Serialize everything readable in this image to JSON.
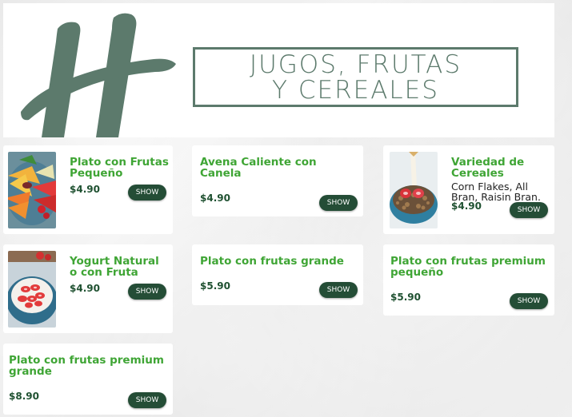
{
  "header": {
    "title_line1": "JUGOS, FRUTAS",
    "title_line2": "Y CEREALES",
    "brand_color": "#5c7a6c"
  },
  "colors": {
    "item_name": "#3fa535",
    "price": "#1f5131",
    "button_bg": "#244d36"
  },
  "items": [
    {
      "name": "Plato con Frutas Pequeño",
      "description": "",
      "price": "$4.90",
      "button": "SHOW",
      "image": "fruit-platter-photo"
    },
    {
      "name": "Avena Caliente con Canela",
      "description": "",
      "price": "$4.90",
      "button": "SHOW",
      "image": ""
    },
    {
      "name": "Variedad de Cereales",
      "description": "Corn Flakes, All Bran, Raisin Bran.",
      "price": "$4.90",
      "button": "SHOW",
      "image": "cereal-bowl-photo"
    },
    {
      "name": "Yogurt Natural o con Fruta",
      "description": "",
      "price": "$4.90",
      "button": "SHOW",
      "image": "yogurt-strawberry-photo"
    },
    {
      "name": "Plato con frutas grande",
      "description": "",
      "price": "$5.90",
      "button": "SHOW",
      "image": ""
    },
    {
      "name": "Plato con frutas premium pequeño",
      "description": "",
      "price": "$5.90",
      "button": "SHOW",
      "image": ""
    },
    {
      "name": "Plato con frutas premium grande",
      "description": "",
      "price": "$8.90",
      "button": "SHOW",
      "image": ""
    }
  ]
}
